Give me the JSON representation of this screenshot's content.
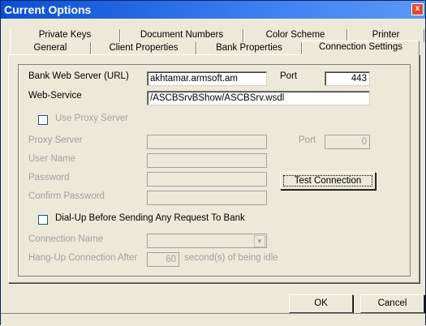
{
  "window": {
    "title": "Current Options",
    "close_glyph": "x"
  },
  "tabs_back": [
    "Private Keys",
    "Document Numbers",
    "Color Scheme",
    "Printer"
  ],
  "tabs_front": [
    "General",
    "Client Properties",
    "Bank Properties",
    "Connection Settings"
  ],
  "selected_tab": "Connection Settings",
  "form": {
    "bank_web_server_label": "Bank Web Server (URL)",
    "bank_web_server_value": "akhtamar.armsoft.am",
    "port_label": "Port",
    "port_value": "443",
    "web_service_label": "Web-Service",
    "web_service_value": "/ASCBSrvBShow/ASCBSrv.wsdl",
    "use_proxy_label": "Use Proxy Server",
    "use_proxy_checked": false,
    "proxy_server_label": "Proxy Server",
    "proxy_port_label": "Port",
    "proxy_port_value": "0",
    "user_name_label": "User Name",
    "password_label": "Password",
    "confirm_password_label": "Confirm Password",
    "test_connection_label": "Test Connection",
    "dialup_label": "Dial-Up Before Sending Any Request To Bank",
    "dialup_checked": false,
    "connection_name_label": "Connection Name",
    "hangup_label": "Hang-Up Connection After",
    "hangup_value": "60",
    "hangup_suffix": "second(s) of being idle"
  },
  "buttons": {
    "ok": "OK",
    "cancel": "Cancel"
  },
  "icons": {
    "close": "close-icon",
    "dropdown": "chevron-down-icon"
  }
}
